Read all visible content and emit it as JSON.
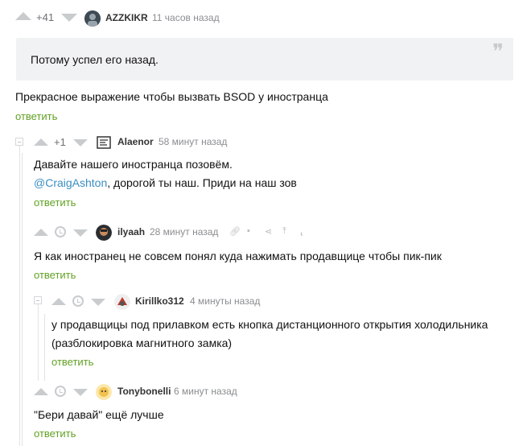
{
  "comments": [
    {
      "rating": "+41",
      "author": "AZZKIKR",
      "time": "11 часов назад",
      "quote": "Потому успел его назад.",
      "text": "Прекрасное выражение чтобы вызвать BSOD у иностранца",
      "reply": "ответить"
    },
    {
      "rating": "+1",
      "author": "Alaenor",
      "time": "58 минут назад",
      "text_line1": "Давайте нашего иностранца позовём.",
      "mention": "@CraigAshton",
      "text_line2_rest": ", дорогой ты наш. Приди на наш зов",
      "reply": "ответить"
    },
    {
      "author": "ilyaah",
      "time": "28 минут назад",
      "text": "Я как иностранец не совсем понял куда нажимать продавщице чтобы пик-пик",
      "reply": "ответить"
    },
    {
      "author": "Kirillko312",
      "time": "4 минуты назад",
      "text_line1": "у продавщицы под прилавком есть кнопка дистанционного открытия холодильника",
      "text_line2": "(разблокировка магнитного замка)",
      "reply": "ответить"
    },
    {
      "author": "Tonybonelli",
      "time": "6 минут назад",
      "text": "\"Бери давай\" ещё лучше",
      "reply": "ответить"
    }
  ],
  "colors": {
    "reply": "#62a124",
    "mention": "#3a8ec4",
    "quote_bg": "#f1f2f3",
    "icon": "#c9ccce"
  }
}
